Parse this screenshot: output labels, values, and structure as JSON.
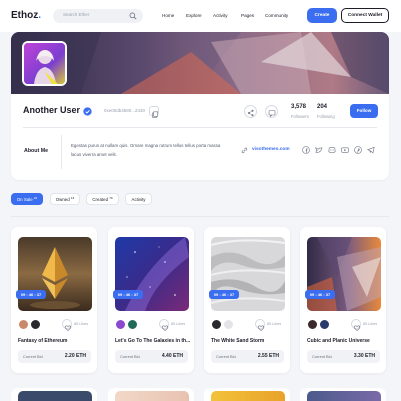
{
  "header": {
    "logo_main": "Ethoz",
    "logo_dot": ".",
    "search_placeholder": "Search Ether",
    "nav": [
      "Home",
      "Explore",
      "Activity",
      "Pages",
      "Community"
    ],
    "create_label": "Create",
    "wallet_label": "Connect Wallet"
  },
  "profile": {
    "name": "Another User",
    "address": "0xe00db4b80...2430",
    "followers_count": "3,578",
    "followers_label": "Followers",
    "following_count": "204",
    "following_label": "Following",
    "follow_label": "Follow",
    "about_title": "About Me",
    "bio": "Egestas purus at nullam quis. Ornare magna rutrum tellus tellus porta massa lacus viverra amet velit.",
    "website": "visothemes.com"
  },
  "tabs": [
    {
      "label": "On Sale",
      "count": "22"
    },
    {
      "label": "Owned",
      "count": "16"
    },
    {
      "label": "Created",
      "count": "79"
    },
    {
      "label": "Activity",
      "count": ""
    }
  ],
  "nfts": [
    {
      "timer": "09 : 46 : 37",
      "likes": "85 Likes",
      "title": "Fantasy of Ethereum",
      "bid_label": "Current Bid",
      "bid": "2.20 ETH"
    },
    {
      "timer": "09 : 46 : 37",
      "likes": "85 Likes",
      "title": "Let's Go To The Galaxies in th...",
      "bid_label": "Current Bid",
      "bid": "4.40 ETH"
    },
    {
      "timer": "09 : 46 : 37",
      "likes": "85 Likes",
      "title": "The White Sand Storm",
      "bid_label": "Current Bid",
      "bid": "2.55 ETH"
    },
    {
      "timer": "09 : 46 : 37",
      "likes": "85 Likes",
      "title": "Cubic and Planic Universe",
      "bid_label": "Current Bid",
      "bid": "3.30 ETH"
    }
  ],
  "colors": {
    "accent": "#3a6df0",
    "background": "#f4f5f8",
    "text": "#1c1d29"
  }
}
